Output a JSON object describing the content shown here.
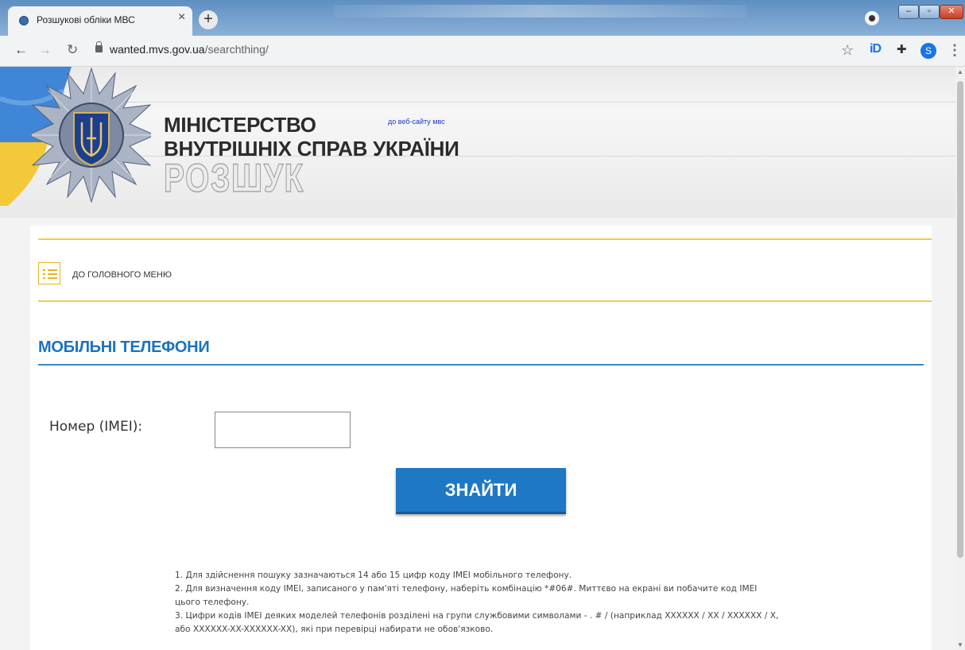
{
  "browser": {
    "tab_title": "Розшукові обліки МВС",
    "tab_close": "×",
    "new_tab": "+",
    "url_host": "wanted.mvs.gov.ua",
    "url_path": "/searchthing/",
    "profile_initial": "S",
    "ext_label": "iD"
  },
  "header": {
    "ministry_line1": "МІНІСТЕРСТВО",
    "ministry_line2": "ВНУТРІШНІХ СПРАВ УКРАЇНИ",
    "site_link": "до веб-сайту мвс",
    "rozshuk": "РОЗШУК"
  },
  "nav": {
    "main_menu_label": "ДО ГОЛОВНОГО МЕНЮ"
  },
  "section": {
    "title": "МОБІЛЬНІ ТЕЛЕФОНИ"
  },
  "form": {
    "imei_label": "Номер (IMEI):",
    "imei_value": "",
    "search_button": "ЗНАЙТИ"
  },
  "notes": [
    "1. Для здійснення пошуку зазначаються 14 або 15 цифр коду IMEI мобільного телефону.",
    "2. Для визначення коду IMEI, записаного у пам'яті телефону, наберіть комбінацію *#06#. Миттєво на екрані ви побачите код IMEI цього телефону.",
    "3. Цифри кодів IMEI деяких моделей телефонів розділені на групи службовими символами - . # / (наприклад XXXXXX / XX / XXXXXX / X, або XXXXXX-XX-XXXXXX-XX), які при перевірці набирати не обов'язково."
  ],
  "colors": {
    "accent_blue": "#1f78c4",
    "section_blue": "#1a73c0",
    "accent_yellow": "#f0cc4c"
  }
}
